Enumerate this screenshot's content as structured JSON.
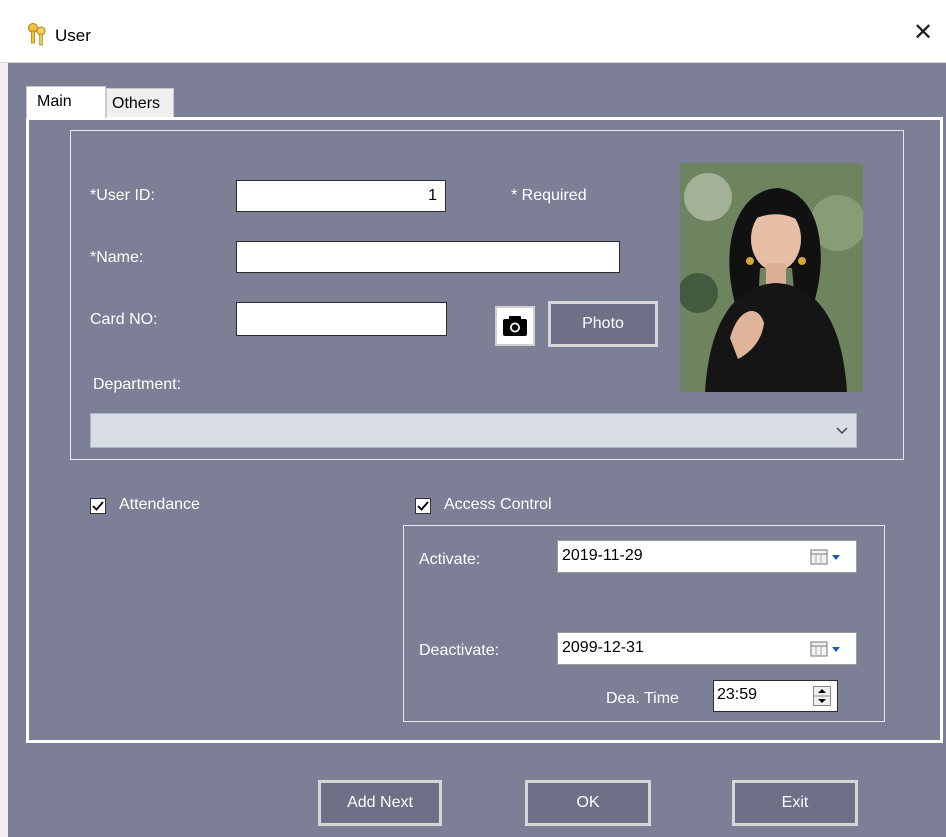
{
  "window": {
    "title": "User"
  },
  "tabs": [
    {
      "label": "Main"
    },
    {
      "label": "Others"
    }
  ],
  "form": {
    "user_id_label": "*User ID:",
    "user_id_value": "1",
    "required_note": "* Required",
    "name_label": "*Name:",
    "name_value": "",
    "card_label": "Card NO:",
    "card_value": "",
    "photo_button": "Photo",
    "department_label": "Department:",
    "department_value": ""
  },
  "options": {
    "attendance_label": "Attendance",
    "attendance_checked": true,
    "access_control_label": "Access Control",
    "access_control_checked": true
  },
  "access": {
    "activate_label": "Activate:",
    "activate_value": "2019-11-29",
    "deactivate_label": "Deactivate:",
    "deactivate_value": "2099-12-31",
    "dea_time_label": "Dea. Time",
    "dea_time_value": "23:59"
  },
  "buttons": {
    "add_next": "Add Next",
    "ok": "OK",
    "exit": "Exit"
  },
  "icons": {
    "title": "key-icon",
    "close": "close-icon",
    "camera": "camera-icon",
    "dropdown": "chevron-down-icon",
    "calendar": "calendar-icon",
    "spinner": "spinner-icon"
  }
}
